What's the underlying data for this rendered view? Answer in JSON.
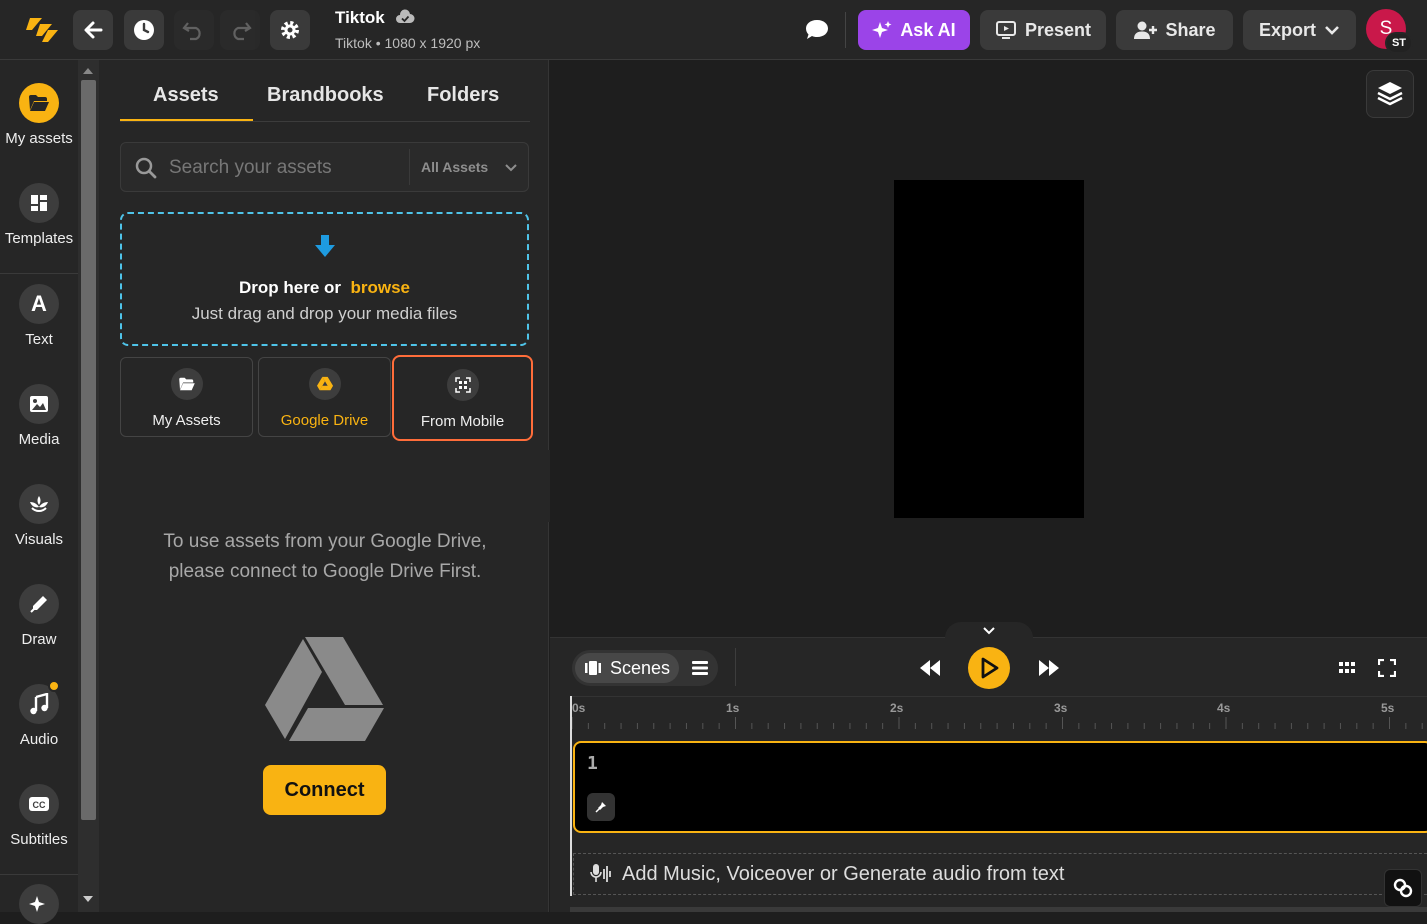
{
  "header": {
    "doc_title": "Tiktok",
    "doc_subtitle": "Tiktok • 1080 x 1920 px",
    "ask_ai_label": "Ask AI",
    "present_label": "Present",
    "share_label": "Share",
    "export_label": "Export",
    "avatar_initial": "S",
    "avatar_badge": "ST",
    "accent_color": "#f9b312",
    "ask_ai_color": "#9b44e8"
  },
  "rail": {
    "items": [
      {
        "label": "My assets",
        "icon": "folder-open-icon"
      },
      {
        "label": "Templates",
        "icon": "templates-icon"
      },
      {
        "label": "Text",
        "icon": "text-icon"
      },
      {
        "label": "Media",
        "icon": "image-icon"
      },
      {
        "label": "Visuals",
        "icon": "visuals-icon"
      },
      {
        "label": "Draw",
        "icon": "pen-icon"
      },
      {
        "label": "Audio",
        "icon": "music-icon"
      },
      {
        "label": "Subtitles",
        "icon": "cc-icon"
      }
    ]
  },
  "panel": {
    "tabs": [
      "Assets",
      "Brandbooks",
      "Folders"
    ],
    "search_placeholder": "Search your assets",
    "filter_label": "All Assets",
    "drop_title": "Drop here or",
    "drop_link": "browse",
    "drop_sub": "Just drag and drop your media files",
    "sources": [
      "My Assets",
      "Google Drive",
      "From Mobile"
    ],
    "info_text": "To use assets from your Google Drive, please connect to Google Drive First.",
    "connect_label": "Connect"
  },
  "timeline": {
    "scenes_label": "Scenes",
    "ticks": [
      "0s",
      "1s",
      "2s",
      "3s",
      "4s",
      "5s"
    ],
    "scene_number": "1",
    "audio_prompt": "Add Music, Voiceover or Generate audio from text"
  }
}
